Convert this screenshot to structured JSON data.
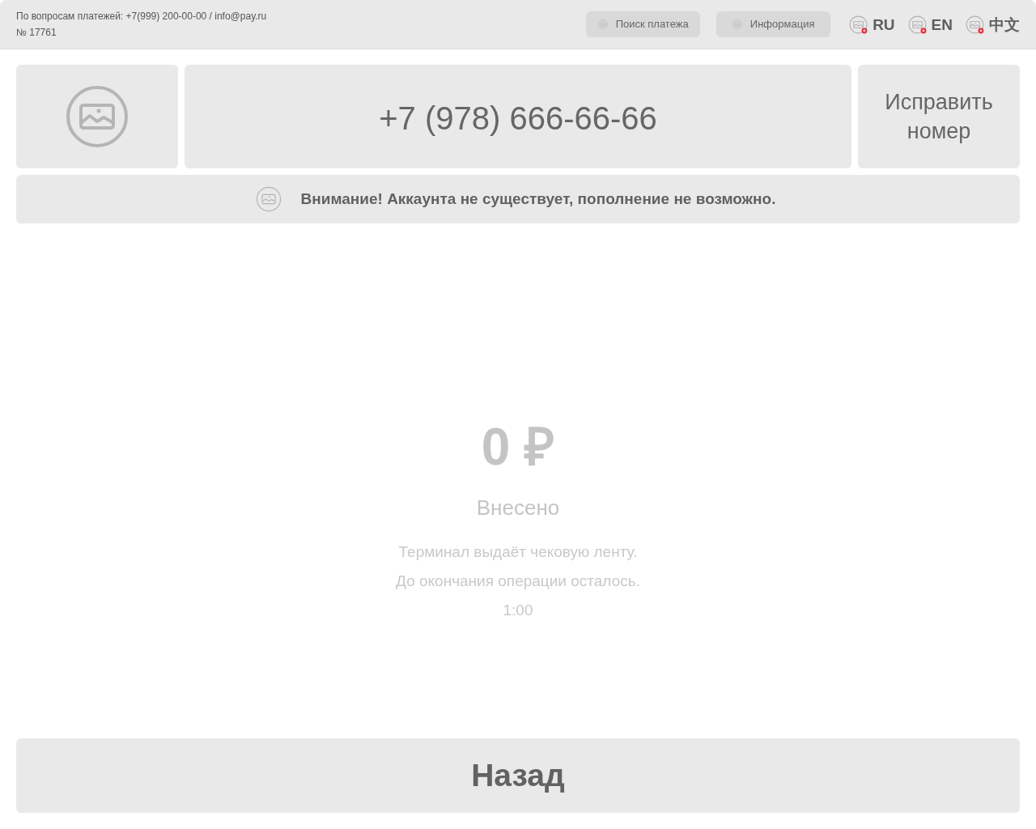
{
  "header": {
    "support_text": "По вопросам платежей: +7(999) 200-00-00 / info@pay.ru",
    "terminal_number": "№ 17761",
    "buttons": [
      {
        "label": "Поиск платежа"
      },
      {
        "label": "Информация"
      }
    ],
    "languages": [
      {
        "label": "RU"
      },
      {
        "label": "EN"
      },
      {
        "label": "中文"
      }
    ]
  },
  "account": {
    "phone": "+7 (978) 666-66-66",
    "fix_button": "Исправить номер"
  },
  "notice": {
    "text": "Внимание! Аккаунта не существует, пополнение не возможно."
  },
  "payment": {
    "amount": "0 ₽",
    "amount_label": "Внесено",
    "messages": [
      "Терминал выдаёт чековую ленту.",
      "До окончания операции осталось.",
      "1:00"
    ]
  },
  "back_button": "Назад"
}
